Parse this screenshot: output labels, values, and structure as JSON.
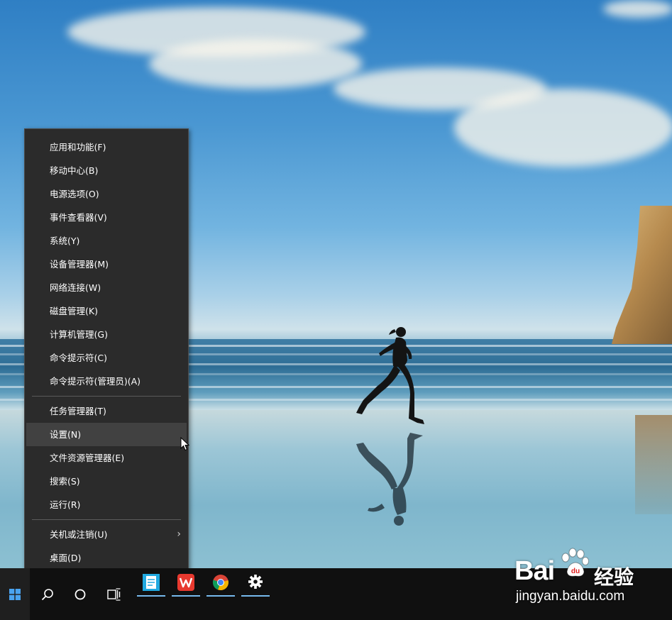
{
  "context_menu": {
    "group1": [
      {
        "label": "应用和功能(F)"
      },
      {
        "label": "移动中心(B)"
      },
      {
        "label": "电源选项(O)"
      },
      {
        "label": "事件查看器(V)"
      },
      {
        "label": "系统(Y)"
      },
      {
        "label": "设备管理器(M)"
      },
      {
        "label": "网络连接(W)"
      },
      {
        "label": "磁盘管理(K)"
      },
      {
        "label": "计算机管理(G)"
      },
      {
        "label": "命令提示符(C)"
      },
      {
        "label": "命令提示符(管理员)(A)"
      }
    ],
    "group2": [
      {
        "label": "任务管理器(T)"
      },
      {
        "label": "设置(N)"
      },
      {
        "label": "文件资源管理器(E)"
      },
      {
        "label": "搜索(S)"
      },
      {
        "label": "运行(R)"
      }
    ],
    "group3": [
      {
        "label": "关机或注销(U)"
      },
      {
        "label": "桌面(D)"
      }
    ],
    "hovered_item": "设置(N)"
  },
  "taskbar": {
    "icons": [
      "windows-start-icon",
      "search-icon",
      "cortana-circle-icon",
      "task-view-icon"
    ],
    "pinned_apps": [
      "notepad-app-icon",
      "wps-office-icon",
      "chrome-icon",
      "settings-gear-icon"
    ],
    "accent_color": "#76b9ed"
  },
  "watermark": {
    "brand": "Bai",
    "brand_suffix": "经验",
    "site": "jingyan.baidu.com"
  },
  "colors": {
    "menu_background": "#2b2b2b",
    "menu_hover": "#414141",
    "taskbar_background": "#101010"
  }
}
